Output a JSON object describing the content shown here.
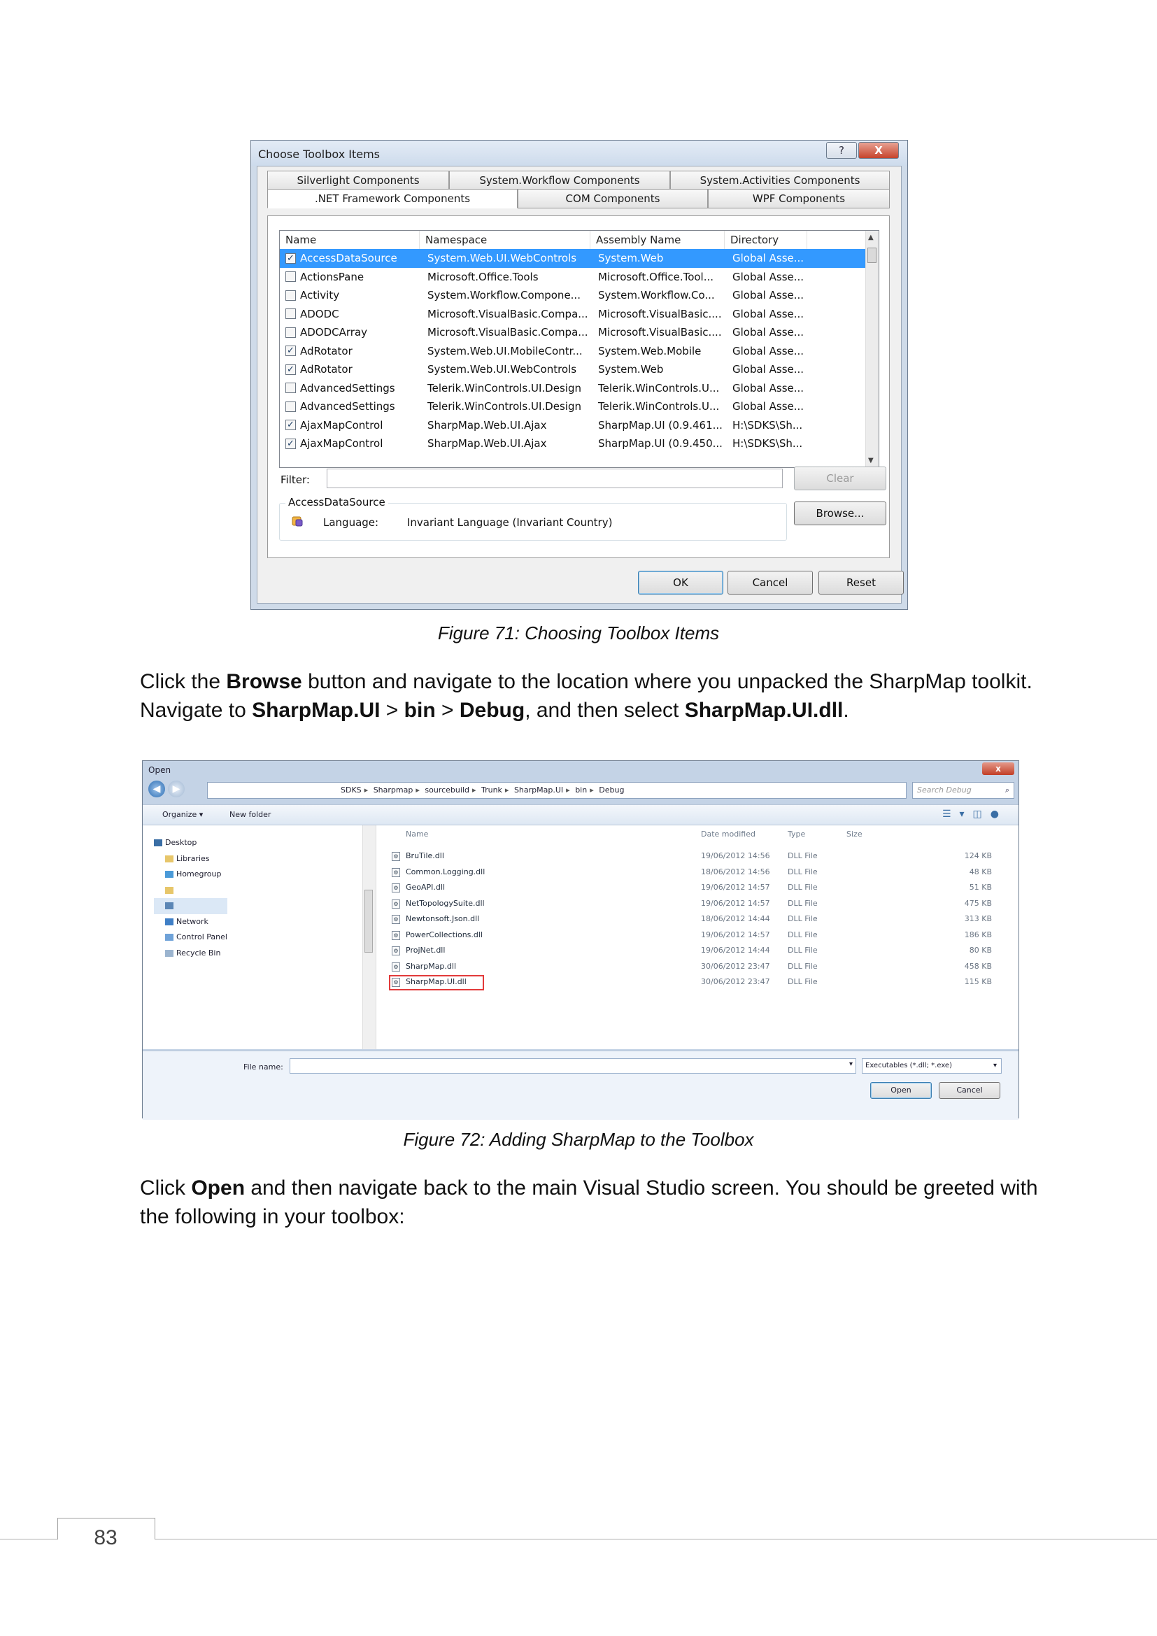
{
  "figure71": {
    "title": "Choose Toolbox Items",
    "help_glyph": "?",
    "close_glyph": "X",
    "tabs_back": [
      "Silverlight Components",
      "System.Workflow Components",
      "System.Activities Components"
    ],
    "tabs_front": [
      ".NET Framework Components",
      "COM Components",
      "WPF Components"
    ],
    "columns": [
      "Name",
      "Namespace",
      "Assembly Name",
      "Directory"
    ],
    "rows": [
      {
        "checked": true,
        "name": "AccessDataSource",
        "namespace": "System.Web.UI.WebControls",
        "assembly": "System.Web",
        "directory": "Global Asse...",
        "selected": true
      },
      {
        "checked": false,
        "name": "ActionsPane",
        "namespace": "Microsoft.Office.Tools",
        "assembly": "Microsoft.Office.Tool...",
        "directory": "Global Asse..."
      },
      {
        "checked": false,
        "name": "Activity",
        "namespace": "System.Workflow.Compone...",
        "assembly": "System.Workflow.Co...",
        "directory": "Global Asse..."
      },
      {
        "checked": false,
        "name": "ADODC",
        "namespace": "Microsoft.VisualBasic.Compa...",
        "assembly": "Microsoft.VisualBasic....",
        "directory": "Global Asse..."
      },
      {
        "checked": false,
        "name": "ADODCArray",
        "namespace": "Microsoft.VisualBasic.Compa...",
        "assembly": "Microsoft.VisualBasic....",
        "directory": "Global Asse..."
      },
      {
        "checked": true,
        "name": "AdRotator",
        "namespace": "System.Web.UI.MobileContr...",
        "assembly": "System.Web.Mobile",
        "directory": "Global Asse..."
      },
      {
        "checked": true,
        "name": "AdRotator",
        "namespace": "System.Web.UI.WebControls",
        "assembly": "System.Web",
        "directory": "Global Asse..."
      },
      {
        "checked": false,
        "name": "AdvancedSettings",
        "namespace": "Telerik.WinControls.UI.Design",
        "assembly": "Telerik.WinControls.U...",
        "directory": "Global Asse..."
      },
      {
        "checked": false,
        "name": "AdvancedSettings",
        "namespace": "Telerik.WinControls.UI.Design",
        "assembly": "Telerik.WinControls.U...",
        "directory": "Global Asse..."
      },
      {
        "checked": true,
        "name": "AjaxMapControl",
        "namespace": "SharpMap.Web.UI.Ajax",
        "assembly": "SharpMap.UI (0.9.461...",
        "directory": "H:\\SDKS\\Sh..."
      },
      {
        "checked": true,
        "name": "AjaxMapControl",
        "namespace": "SharpMap.Web.UI.Ajax",
        "assembly": "SharpMap.UI (0.9.450...",
        "directory": "H:\\SDKS\\Sh..."
      }
    ],
    "filter_label": "Filter:",
    "filter_value": "",
    "clear_label": "Clear",
    "browse_label": "Browse...",
    "group_title": "AccessDataSource",
    "language_label": "Language:",
    "language_value": "Invariant Language (Invariant Country)",
    "ok_label": "OK",
    "cancel_label": "Cancel",
    "reset_label": "Reset",
    "caption": "Figure 71: Choosing Toolbox Items"
  },
  "para1": {
    "t1": "Click the ",
    "b1": "Browse",
    "t2": " button and navigate to the location where you unpacked the SharpMap toolkit. Navigate to ",
    "b2": "SharpMap.UI",
    "t3": " > ",
    "b3": "bin",
    "t4": " > ",
    "b4": "Debug",
    "t5": ", and then select ",
    "b5": "SharpMap.UI.dll",
    "t6": "."
  },
  "figure72": {
    "title": "Open",
    "close_glyph": "x",
    "path": [
      "SDKS",
      "Sharpmap",
      "sourcebuild",
      "Trunk",
      "SharpMap.UI",
      "bin",
      "Debug"
    ],
    "search_placeholder": "Search Debug",
    "organize_label": "Organize ▾",
    "newfolder_label": "New folder",
    "tree": [
      "Desktop",
      "Libraries",
      "Homegroup",
      "",
      "",
      "Network",
      "Control Panel",
      "Recycle Bin"
    ],
    "col_name": "Name",
    "col_date": "Date modified",
    "col_type": "Type",
    "col_size": "Size",
    "files": [
      {
        "name": "BruTile.dll",
        "date": "19/06/2012 14:56",
        "type": "DLL File",
        "size": "124 KB"
      },
      {
        "name": "Common.Logging.dll",
        "date": "18/06/2012 14:56",
        "type": "DLL File",
        "size": "48 KB"
      },
      {
        "name": "GeoAPI.dll",
        "date": "19/06/2012 14:57",
        "type": "DLL File",
        "size": "51 KB"
      },
      {
        "name": "NetTopologySuite.dll",
        "date": "19/06/2012 14:57",
        "type": "DLL File",
        "size": "475 KB"
      },
      {
        "name": "Newtonsoft.Json.dll",
        "date": "18/06/2012 14:44",
        "type": "DLL File",
        "size": "313 KB"
      },
      {
        "name": "PowerCollections.dll",
        "date": "19/06/2012 14:57",
        "type": "DLL File",
        "size": "186 KB"
      },
      {
        "name": "ProjNet.dll",
        "date": "19/06/2012 14:44",
        "type": "DLL File",
        "size": "80 KB"
      },
      {
        "name": "SharpMap.dll",
        "date": "30/06/2012 23:47",
        "type": "DLL File",
        "size": "458 KB"
      },
      {
        "name": "SharpMap.UI.dll",
        "date": "30/06/2012 23:47",
        "type": "DLL File",
        "size": "115 KB",
        "highlighted": true
      }
    ],
    "filename_label": "File name:",
    "filename_value": "",
    "filetype_value": "Executables (*.dll; *.exe)",
    "open_label": "Open",
    "cancel_label": "Cancel",
    "caption": "Figure 72: Adding SharpMap to the Toolbox"
  },
  "para2": {
    "t1": "Click ",
    "b1": "Open",
    "t2": " and then navigate back to the main Visual Studio screen. You should be greeted with the following in your toolbox:"
  },
  "page_number": "83"
}
